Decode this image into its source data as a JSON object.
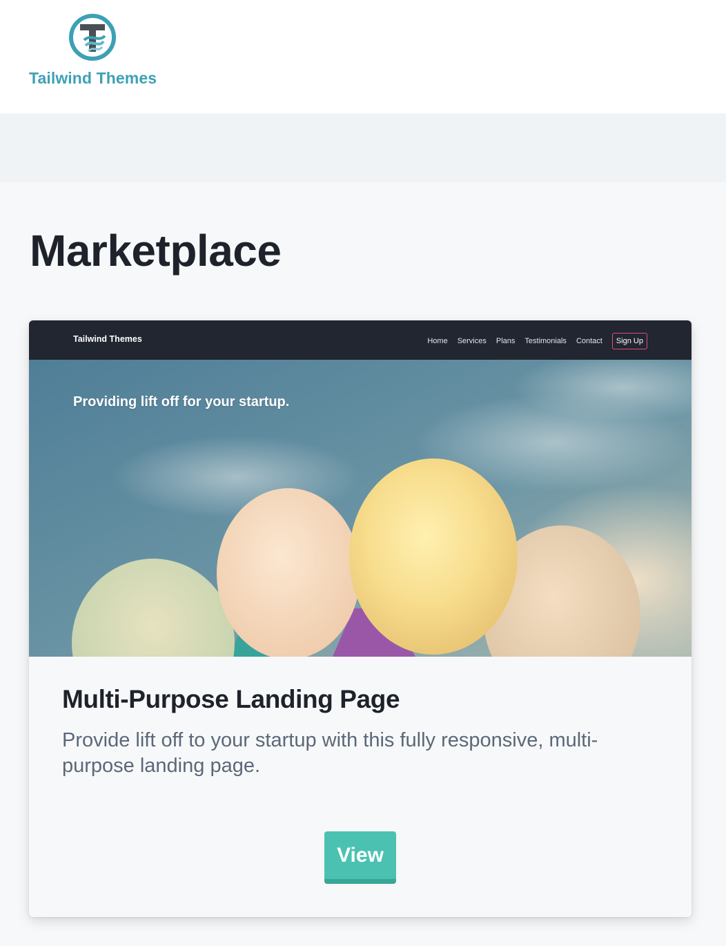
{
  "header": {
    "logo_text": "Tailwind Themes",
    "logo_icon": "tailwind-themes-logo-icon"
  },
  "page": {
    "title": "Marketplace"
  },
  "card": {
    "preview": {
      "brand": "Tailwind Themes",
      "nav_items": [
        "Home",
        "Services",
        "Plans",
        "Testimonials",
        "Contact"
      ],
      "signup_label": "Sign Up",
      "hero_text": "Providing lift off for your startup.",
      "hero_image": "balloons-sky-image"
    },
    "title": "Multi-Purpose Landing Page",
    "description": "Provide lift off to your startup with this fully responsive, multi-purpose landing page.",
    "button_label": "View"
  },
  "colors": {
    "brand_teal": "#3da0b6",
    "button_teal": "#4bc2b1",
    "nav_dark": "#212630",
    "signup_pink": "#e64a7d",
    "title_dark": "#1e232b",
    "body_gray": "#5b6878"
  }
}
